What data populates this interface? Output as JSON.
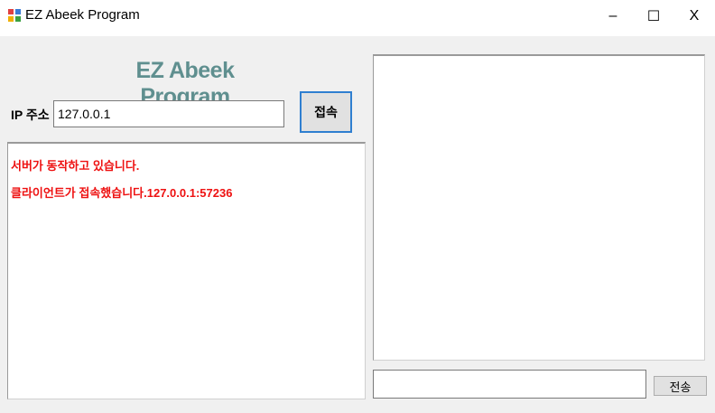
{
  "window": {
    "title": "EZ Abeek Program",
    "icon": "app-window-icon",
    "controls": {
      "minimize": "–",
      "maximize": "☐",
      "close": "X"
    }
  },
  "header": {
    "title": "EZ Abeek Program"
  },
  "connection": {
    "ip_label": "IP 주소",
    "ip_value": "127.0.0.1",
    "connect_label": "접속"
  },
  "log": {
    "lines": [
      "서버가 동작하고 있습니다.",
      "클라이언트가 접속했습니다.127.0.0.1:57236"
    ],
    "color": "#ee1111"
  },
  "chat": {
    "message_value": "",
    "send_label": "전송"
  },
  "colors": {
    "header_title": "#5f8f8f",
    "connect_border": "#2f7fd0",
    "background": "#f0f0f0"
  }
}
